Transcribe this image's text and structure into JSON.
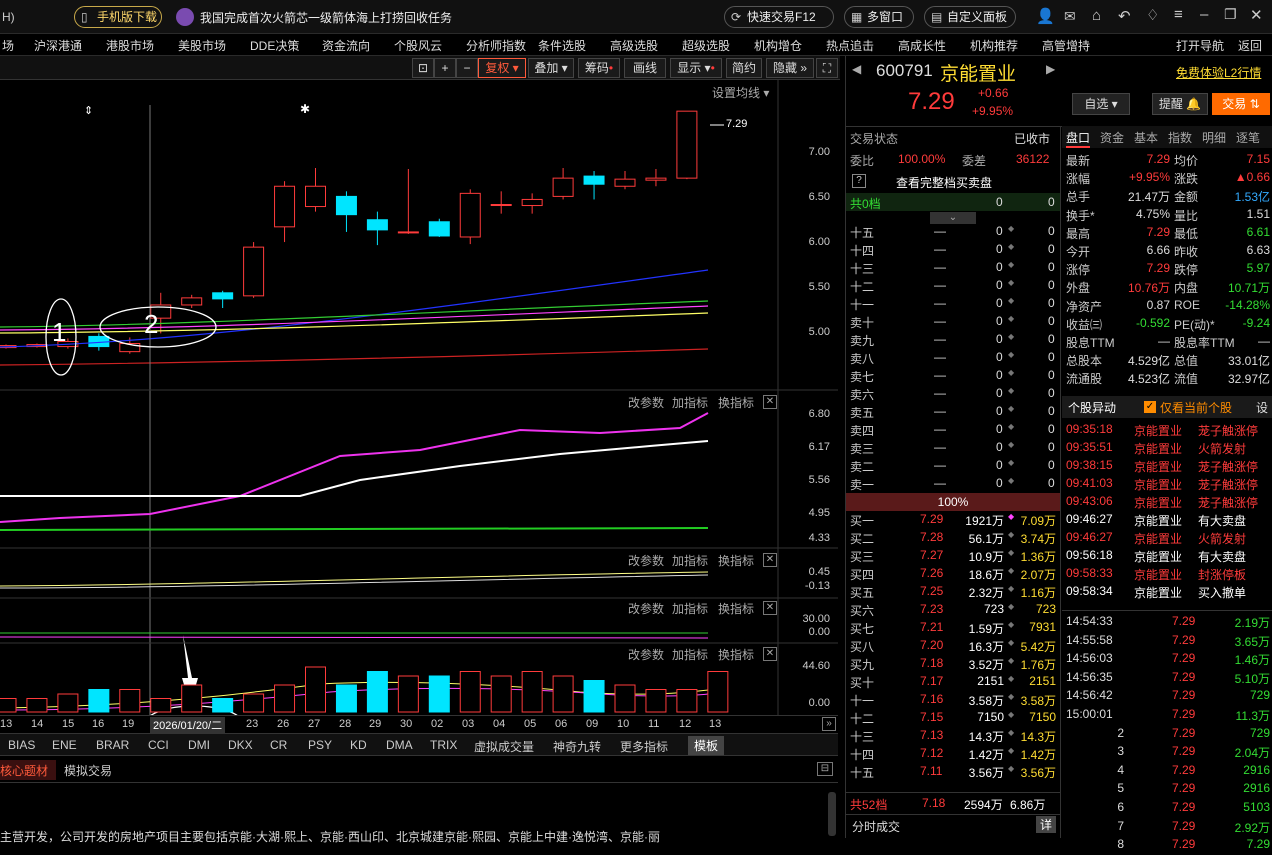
{
  "topbar": {
    "left_frag": "H)",
    "mobile_download": "手机版下载",
    "headline": "我国完成首次火箭芯一级箭体海上打捞回收任务",
    "quick_trade": "快速交易F12",
    "multi_window": "多窗口",
    "custom_panel": "自定义面板"
  },
  "menu": [
    "场",
    "沪深港通",
    "港股市场",
    "美股市场",
    "DDE决策",
    "资金流向",
    "个股风云",
    "分析师指数",
    "条件选股",
    "高级选股",
    "超级选股",
    "机构增仓",
    "热点追击",
    "高成长性",
    "机构推荐",
    "高管增持",
    "打开导航",
    "返回"
  ],
  "toolbar": {
    "fuquan": "复权",
    "diejia": "叠加",
    "chouma": "筹码",
    "huaxian": "画线",
    "xianshi": "显示",
    "jianyue": "简约",
    "yincang": "隐藏"
  },
  "chart": {
    "settings": "设置均线",
    "price_label": "7.29",
    "panel_btns": [
      "改参数",
      "加指标",
      "换指标"
    ],
    "annotations": [
      "1",
      "2"
    ],
    "main_y": [
      "7.00",
      "6.50",
      "6.00",
      "5.50",
      "5.00"
    ],
    "p2_y": [
      "6.80",
      "6.17",
      "5.56",
      "4.95",
      "4.33"
    ],
    "p3_y": [
      "0.45",
      "-0.13"
    ],
    "p4_y": [
      "30.00",
      "0.00"
    ],
    "p5_y": [
      "44.60",
      "0.00"
    ],
    "dates": [
      "13",
      "14",
      "15",
      "16",
      "19",
      "2026/01/20/二",
      "23",
      "26",
      "27",
      "28",
      "29",
      "30",
      "02",
      "03",
      "04",
      "05",
      "06",
      "09",
      "10",
      "11",
      "12",
      "13"
    ]
  },
  "chart_data": {
    "type": "candlestick",
    "categories": [
      "13",
      "14",
      "15",
      "16",
      "19",
      "20",
      "21",
      "22",
      "23",
      "26",
      "27",
      "28",
      "29",
      "30",
      "02",
      "03",
      "04",
      "05",
      "06",
      "09",
      "10",
      "11",
      "12",
      "13"
    ],
    "candles": [
      {
        "o": 4.96,
        "c": 4.98,
        "h": 4.99,
        "l": 4.95
      },
      {
        "o": 4.97,
        "c": 4.99,
        "h": 5.0,
        "l": 4.96
      },
      {
        "o": 4.97,
        "c": 5.02,
        "h": 5.05,
        "l": 4.95
      },
      {
        "o": 5.07,
        "c": 4.97,
        "h": 5.1,
        "l": 4.93
      },
      {
        "o": 4.92,
        "c": 5.0,
        "h": 5.06,
        "l": 4.9
      },
      {
        "o": 5.25,
        "c": 5.38,
        "h": 5.5,
        "l": 5.1
      },
      {
        "o": 5.38,
        "c": 5.45,
        "h": 5.48,
        "l": 5.35
      },
      {
        "o": 5.5,
        "c": 5.44,
        "h": 5.52,
        "l": 5.35
      },
      {
        "o": 5.47,
        "c": 5.95,
        "h": 6.0,
        "l": 5.45
      },
      {
        "o": 6.15,
        "c": 6.55,
        "h": 6.6,
        "l": 6.0
      },
      {
        "o": 6.35,
        "c": 6.55,
        "h": 6.73,
        "l": 6.3
      },
      {
        "o": 6.45,
        "c": 6.27,
        "h": 6.5,
        "l": 6.1
      },
      {
        "o": 6.22,
        "c": 6.12,
        "h": 6.3,
        "l": 5.97
      },
      {
        "o": 6.1,
        "c": 6.1,
        "h": 6.72,
        "l": 6.08
      },
      {
        "o": 6.2,
        "c": 6.06,
        "h": 6.23,
        "l": 6.05
      },
      {
        "o": 6.05,
        "c": 6.48,
        "h": 6.52,
        "l": 5.98
      },
      {
        "o": 6.37,
        "c": 6.37,
        "h": 6.5,
        "l": 6.28
      },
      {
        "o": 6.36,
        "c": 6.42,
        "h": 6.48,
        "l": 6.28
      },
      {
        "o": 6.45,
        "c": 6.63,
        "h": 6.73,
        "l": 6.42
      },
      {
        "o": 6.65,
        "c": 6.57,
        "h": 6.7,
        "l": 6.42
      },
      {
        "o": 6.55,
        "c": 6.62,
        "h": 6.7,
        "l": 6.52
      },
      {
        "o": 6.61,
        "c": 6.63,
        "h": 6.72,
        "l": 6.55
      },
      {
        "o": 6.63,
        "c": 7.29,
        "h": 7.29,
        "l": 6.62
      }
    ],
    "ylim": [
      4.68,
      7.4
    ]
  },
  "right": {
    "code": "600791",
    "name": "京能置业",
    "free_l2": "免费体验L2行情",
    "price": "7.29",
    "change": "+0.66",
    "change_pct": "+9.95%",
    "btn_zixuan": "自选",
    "btn_tixing": "提醒",
    "btn_jiaoyi": "交易",
    "trade_status_label": "交易状态",
    "trade_status": "已收市",
    "weibi_label": "委比",
    "weibi": "100.00%",
    "weicha_label": "委差",
    "weicha": "36122",
    "full_book": "查看完整档买卖盘",
    "zero_level": "共0档",
    "sell_levels": [
      "十五",
      "十四",
      "十三",
      "十二",
      "十一",
      "卖十",
      "卖九",
      "卖八",
      "卖七",
      "卖六",
      "卖五",
      "卖四",
      "卖三",
      "卖二",
      "卖一"
    ],
    "ratio": "100%",
    "buy_levels": [
      [
        "买一",
        "7.29",
        "1921万",
        "7.09万"
      ],
      [
        "买二",
        "7.28",
        "56.1万",
        "3.74万"
      ],
      [
        "买三",
        "7.27",
        "10.9万",
        "1.36万"
      ],
      [
        "买四",
        "7.26",
        "18.6万",
        "2.07万"
      ],
      [
        "买五",
        "7.25",
        "2.32万",
        "1.16万"
      ],
      [
        "买六",
        "7.23",
        "723",
        "723"
      ],
      [
        "买七",
        "7.21",
        "1.59万",
        "7931"
      ],
      [
        "买八",
        "7.20",
        "16.3万",
        "5.42万"
      ],
      [
        "买九",
        "7.18",
        "3.52万",
        "1.76万"
      ],
      [
        "买十",
        "7.17",
        "2151",
        "2151"
      ],
      [
        "十一",
        "7.16",
        "3.58万",
        "3.58万"
      ],
      [
        "十二",
        "7.15",
        "7150",
        "7150"
      ],
      [
        "十三",
        "7.13",
        "14.3万",
        "14.3万"
      ],
      [
        "十四",
        "7.12",
        "1.42万",
        "1.42万"
      ],
      [
        "十五",
        "7.11",
        "3.56万",
        "3.56万"
      ]
    ],
    "total_levels": [
      "共52档",
      "7.18",
      "2594万",
      "6.86万"
    ],
    "fenshi": "分时成交",
    "detail": "详",
    "tabs": [
      "盘口",
      "资金",
      "基本",
      "指数",
      "明细",
      "逐笔"
    ],
    "stats": [
      [
        "最新",
        "7.29",
        "均价",
        "7.15"
      ],
      [
        "涨幅",
        "+9.95%",
        "涨跌",
        "▲0.66"
      ],
      [
        "总手",
        "21.47万",
        "金额",
        "1.53亿"
      ],
      [
        "换手*",
        "4.75%",
        "量比",
        "1.51"
      ],
      [
        "最高",
        "7.29",
        "最低",
        "6.61"
      ],
      [
        "今开",
        "6.66",
        "昨收",
        "6.63"
      ],
      [
        "涨停",
        "7.29",
        "跌停",
        "5.97"
      ],
      [
        "外盘",
        "10.76万",
        "内盘",
        "10.71万"
      ],
      [
        "净资产",
        "0.87",
        "ROE",
        "-14.28%"
      ],
      [
        "收益㈢",
        "-0.592",
        "PE(动)*",
        "-9.24"
      ],
      [
        "股息TTM",
        "—",
        "股息率TTM",
        "—"
      ],
      [
        "总股本",
        "4.529亿",
        "总值",
        "33.01亿"
      ],
      [
        "流通股",
        "4.523亿",
        "流值",
        "32.97亿"
      ]
    ],
    "yidong_title": "个股异动",
    "yidong_check": "仅看当前个股",
    "yidong_set": "设",
    "yidong": [
      [
        "09:35:18",
        "京能置业",
        "茏子触涨停"
      ],
      [
        "09:35:51",
        "京能置业",
        "火箭发射"
      ],
      [
        "09:38:15",
        "京能置业",
        "茏子触涨停"
      ],
      [
        "09:41:03",
        "京能置业",
        "茏子触涨停"
      ],
      [
        "09:43:06",
        "京能置业",
        "茏子触涨停"
      ],
      [
        "09:46:27",
        "京能置业",
        "有大卖盘"
      ],
      [
        "09:46:27",
        "京能置业",
        "火箭发射"
      ],
      [
        "09:56:18",
        "京能置业",
        "有大卖盘"
      ],
      [
        "09:58:33",
        "京能置业",
        "封涨停板"
      ],
      [
        "09:58:34",
        "京能置业",
        "买入撤单"
      ]
    ],
    "ticks": [
      [
        "14:54:33",
        "7.29",
        "2.19万"
      ],
      [
        "14:55:58",
        "7.29",
        "3.65万"
      ],
      [
        "14:56:03",
        "7.29",
        "1.46万"
      ],
      [
        "14:56:35",
        "7.29",
        "5.10万"
      ],
      [
        "14:56:42",
        "7.29",
        "729"
      ],
      [
        "15:00:01",
        "7.29",
        "11.3万"
      ],
      [
        "2",
        "7.29",
        "729"
      ],
      [
        "3",
        "7.29",
        "2.04万"
      ],
      [
        "4",
        "7.29",
        "2916"
      ],
      [
        "5",
        "7.29",
        "2916"
      ],
      [
        "6",
        "7.29",
        "5103"
      ],
      [
        "7",
        "7.29",
        "2.92万"
      ],
      [
        "8",
        "7.29",
        "7.29"
      ]
    ]
  },
  "indicators": [
    "BIAS",
    "ENE",
    "BRAR",
    "CCI",
    "DMI",
    "DKX",
    "CR",
    "PSY",
    "KD",
    "DMA",
    "TRIX",
    "虚拟成交量",
    "神奇九转",
    "更多指标",
    "模板"
  ],
  "bottom": {
    "tab1": "核心题材",
    "tab2": "模拟交易",
    "text": "主营开发，公司开发的房地产项目主要包括京能·大湖·熙上、京能·西山印、北京城建京能·熙园、京能上中建·逸悦湾、京能·丽"
  },
  "colors": {
    "up": "#ff3b3b",
    "down": "#00e5ff",
    "accent": "#ff8c00"
  }
}
